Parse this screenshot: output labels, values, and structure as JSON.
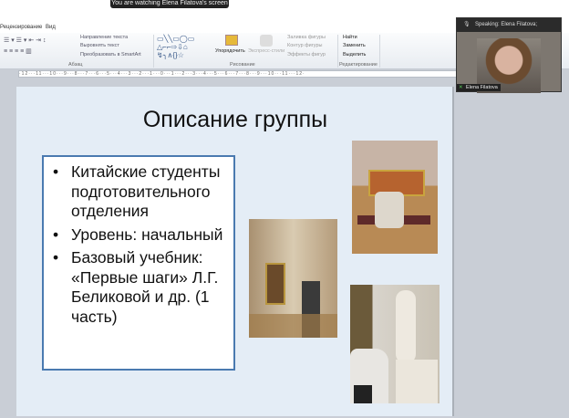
{
  "banner": "You are watching Elena Filatova's screen",
  "tabs": [
    "Рецензирование",
    "Вид"
  ],
  "ribbon": {
    "paragraph": {
      "items": [
        "Направление текста",
        "Выровнять текст",
        "Преобразовать в SmartArt"
      ],
      "label": "Абзац"
    },
    "drawing": {
      "items": [
        "Упорядочить",
        "Экспресс-стили",
        "Заливка фигуры",
        "Контур фигуры",
        "Эффекты фигур"
      ],
      "label": "Рисование"
    },
    "editing": {
      "items": [
        "Найти",
        "Заменить",
        "Выделить"
      ],
      "label": "Редактирование"
    }
  },
  "ruler": "·12···11···10···9···8···7···6···5···4···3···2···1···0···1···2···3···4···5···6···7···8···9···10···11···12·",
  "video": {
    "speaking": "Speaking:  Elena Filatova;",
    "name": "Elena Filatova"
  },
  "slide": {
    "title": "Описание группы",
    "bullets": [
      "Китайские студенты подготовительного отделения",
      "Уровень: начальный",
      "Базовый учебник: «Первые шаги» Л.Г. Беликовой и др. (1 часть)"
    ]
  }
}
